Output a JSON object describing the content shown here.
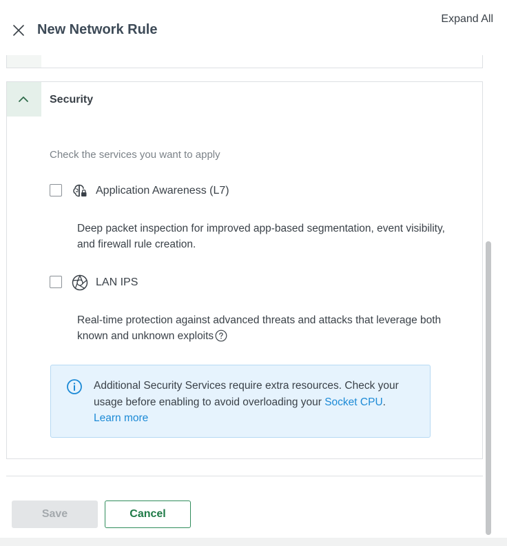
{
  "header": {
    "title": "New Network Rule",
    "expand_all": "Expand All"
  },
  "security": {
    "title": "Security",
    "hint": "Check the services you want to apply",
    "options": [
      {
        "label": "Application Awareness (L7)",
        "description": "Deep packet inspection for improved app-based segmentation, event visibility, and firewall rule creation.",
        "icon": "brain-lock-icon",
        "checked": false
      },
      {
        "label": "LAN IPS",
        "description": "Real-time protection against advanced threats and attacks that leverage both known and unknown exploits",
        "icon": "shutter-shield-icon",
        "checked": false
      }
    ],
    "info": {
      "text_before": "Additional Security Services require extra resources. Check your usage before enabling to avoid overloading your ",
      "link_socket": "Socket CPU",
      "text_after": ".",
      "link_learn": "Learn more"
    }
  },
  "footer": {
    "save_label": "Save",
    "cancel_label": "Cancel"
  },
  "colors": {
    "accent_green": "#1f7a47",
    "toggle_bg": "#e5f0ea",
    "info_bg": "#e6f3fd",
    "link_blue": "#1c8ad6"
  }
}
